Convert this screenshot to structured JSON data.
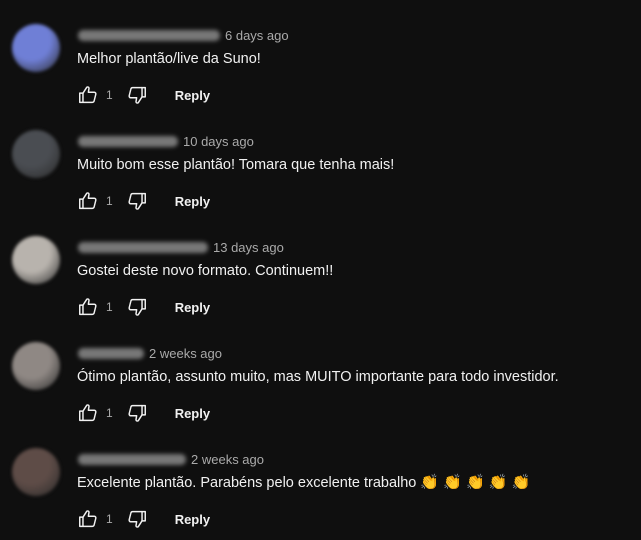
{
  "comments": [
    {
      "avatar_color": "#6f7fd6",
      "handle_width": 142,
      "time": "6 days ago",
      "text": "Melhor plantão/live da Suno!",
      "likes": "1",
      "reply_label": "Reply"
    },
    {
      "avatar_color": "#4a4d52",
      "handle_width": 100,
      "time": "10 days ago",
      "text": "Muito bom esse plantão! Tomara que tenha mais!",
      "likes": "1",
      "reply_label": "Reply"
    },
    {
      "avatar_color": "#b8b3ad",
      "handle_width": 130,
      "time": "13 days ago",
      "text": "Gostei deste novo formato. Continuem!!",
      "likes": "1",
      "reply_label": "Reply"
    },
    {
      "avatar_color": "#8f8884",
      "handle_width": 66,
      "time": "2 weeks ago",
      "text": "Ótimo plantão, assunto muito, mas MUITO importante para todo investidor.",
      "likes": "1",
      "reply_label": "Reply"
    },
    {
      "avatar_color": "#5e4c47",
      "handle_width": 108,
      "time": "2 weeks ago",
      "text": "Excelente plantão. Parabéns pelo excelente trabalho",
      "emoji": "👏 👏 👏 👏 👏",
      "likes": "1",
      "reply_label": "Reply"
    }
  ],
  "icons": {
    "like": "thumbs-up-icon",
    "dislike": "thumbs-down-icon"
  },
  "colors": {
    "background": "#0f0f0f",
    "text_primary": "#f1f1f1",
    "text_secondary": "#aaaaaa"
  }
}
